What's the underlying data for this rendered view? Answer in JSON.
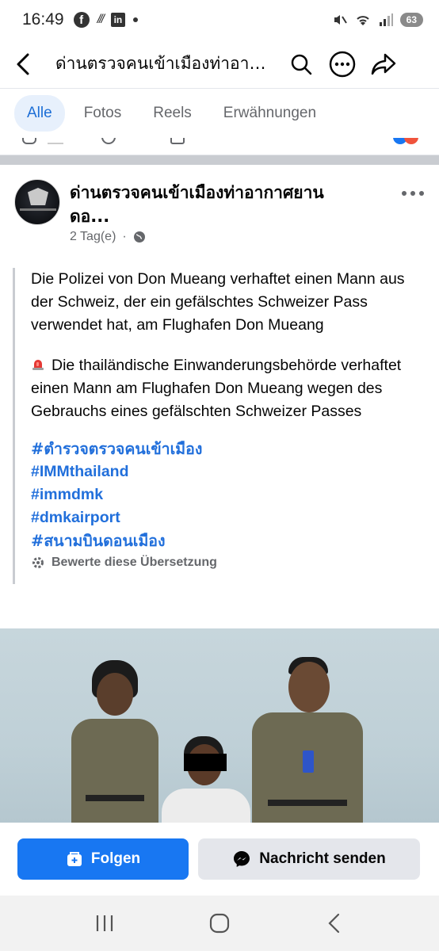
{
  "status_bar": {
    "time": "16:49",
    "battery": "63"
  },
  "header": {
    "title": "ด่านตรวจคนเข้าเมืองท่าอากาศยานดอนเมือง",
    "icons": [
      "back-arrow-icon",
      "search-icon",
      "more-icon",
      "share-icon"
    ]
  },
  "tabs": [
    {
      "label": "Alle",
      "active": true
    },
    {
      "label": "Fotos",
      "active": false
    },
    {
      "label": "Reels",
      "active": false
    },
    {
      "label": "Erwähnungen",
      "active": false
    }
  ],
  "post": {
    "author_line1": "ด่านตรวจคนเข้าเมืองท่าอากาศยาน",
    "author_line2": "ดอ...",
    "time": "2 Tag(e)",
    "paragraph1": "Die Polizei von Don Mueang verhaftet einen Mann aus der Schweiz, der ein gefälschtes Schweizer Pass verwendet hat, am Flughafen Don Mueang",
    "paragraph2": "Die thailändische Einwanderungsbehörde verhaftet einen Mann am Flughafen Don Mueang wegen des Gebrauchs eines gefälschten Schweizer Passes",
    "hashtags": [
      "#ตำรวจตรวจคนเข้าเมือง",
      "#IMMthailand",
      "#immdmk",
      "#dmkairport",
      "#สนามบินดอนเมือง"
    ],
    "rate_translation": "Bewerte diese Übersetzung"
  },
  "actions": {
    "follow": "Folgen",
    "message": "Nachricht senden"
  },
  "colors": {
    "accent": "#1877f2",
    "hashtag": "#216fdb",
    "tab_active_bg": "#e7f0fc"
  }
}
